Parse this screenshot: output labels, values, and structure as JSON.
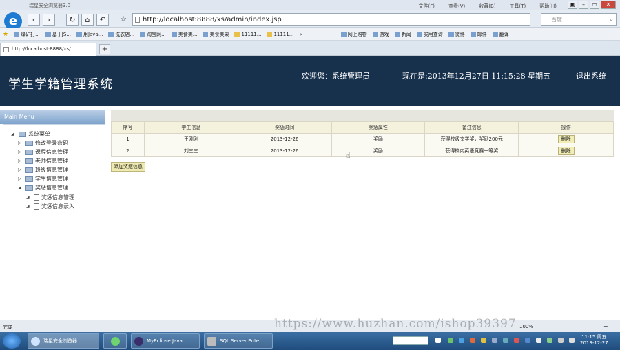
{
  "browser": {
    "title": "瑞星安全浏览器3.0",
    "menu": [
      "文件(F)",
      "查看(V)",
      "收藏(B)",
      "工具(T)",
      "帮助(H)"
    ],
    "url": "http://localhost:8888/xs/admin/index.jsp",
    "search_placeholder": "百度",
    "bookmarks": [
      "煤矿打...",
      "基于JS...",
      "用Java...",
      "洗衣店...",
      "淘宝网...",
      "美食美...",
      "美食美果",
      "11111...",
      "11111...",
      "网上购物",
      "游戏",
      "新闻",
      "实用查询",
      "微博",
      "邮件",
      "翻译"
    ],
    "tab_title": "http://localhost:8888/xs/...",
    "status_text": "完成",
    "zoom": "100%"
  },
  "header": {
    "system_title": "学生学籍管理系统",
    "welcome": "欢迎您：系统管理员",
    "datetime": "现在是:2013年12月27日  11:15:28 星期五",
    "logout": "退出系统"
  },
  "sidebar": {
    "main_menu": "Main Menu",
    "root": "系统菜单",
    "items": [
      {
        "label": "修改登录密码"
      },
      {
        "label": "课程信息管理"
      },
      {
        "label": "老师信息管理"
      },
      {
        "label": "班级信息管理"
      },
      {
        "label": "学生信息管理"
      },
      {
        "label": "奖惩信息管理"
      }
    ],
    "subitems": [
      {
        "label": "奖惩信息管理"
      },
      {
        "label": "奖惩信息录入"
      }
    ]
  },
  "table": {
    "headers": [
      "序号",
      "学生信息",
      "奖惩时间",
      "奖惩属性",
      "备注信息",
      "操作"
    ],
    "rows": [
      {
        "no": "1",
        "student": "王刚刚",
        "date": "2013-12-26",
        "type": "奖励",
        "note": "获得校级文学奖，奖励200元",
        "action": "删除"
      },
      {
        "no": "2",
        "student": "刘三三",
        "date": "2013-12-26",
        "type": "奖励",
        "note": "获得校内英语竞赛一等奖",
        "action": "删除"
      }
    ],
    "add_button": "添加奖惩信息"
  },
  "taskbar": {
    "items": [
      "瑞星安全浏览器",
      "MyEclipse Java ...",
      "SQL Server Ente..."
    ],
    "clock_time": "11:15 周五",
    "clock_date": "2013-12-27"
  },
  "watermark": "https://www.huzhan.com/ishop39397"
}
